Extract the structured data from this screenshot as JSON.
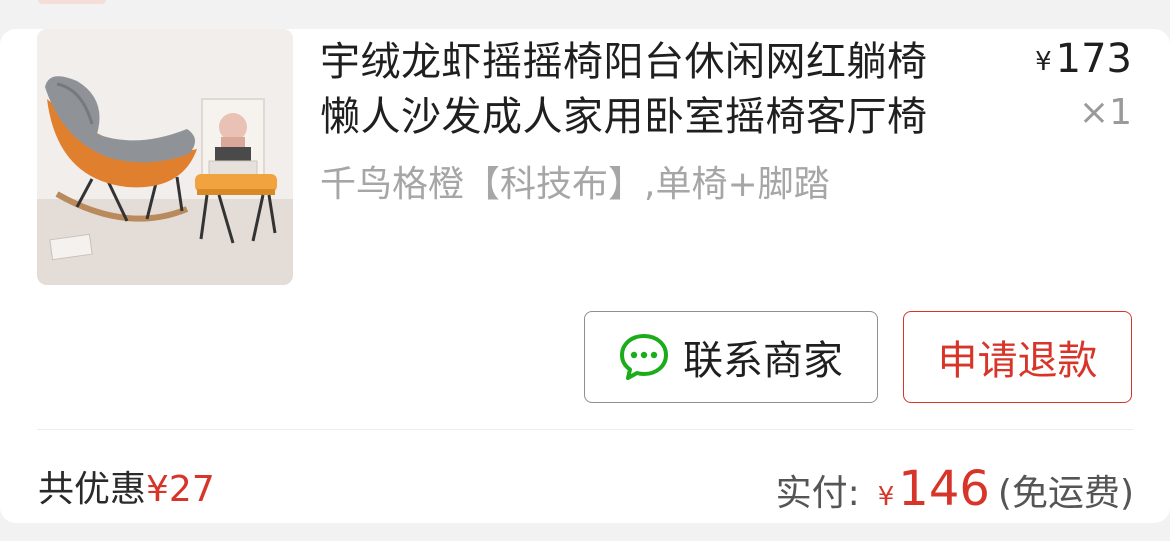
{
  "order_item": {
    "title_line1": "宇绒龙虾摇摇椅阳台休闲网红躺椅",
    "title_line2": "懒人沙发成人家用卧室摇椅客厅椅",
    "price_symbol": "¥",
    "price": "173",
    "quantity": "×1",
    "spec": "千鸟格橙【科技布】,单椅+脚踏",
    "image_icon": "rocking-chair-product-photo"
  },
  "actions": {
    "contact_label": "联系商家",
    "contact_icon": "chat-bubble-icon",
    "refund_label": "申请退款"
  },
  "summary": {
    "discount_label": "共优惠",
    "discount_amount": "¥27",
    "paid_label": "实付:",
    "paid_symbol": "¥",
    "paid_amount": "146",
    "shipping_note": "(免运费)"
  },
  "colors": {
    "accent_red": "#d8352a",
    "wechat_green": "#1aad19"
  }
}
